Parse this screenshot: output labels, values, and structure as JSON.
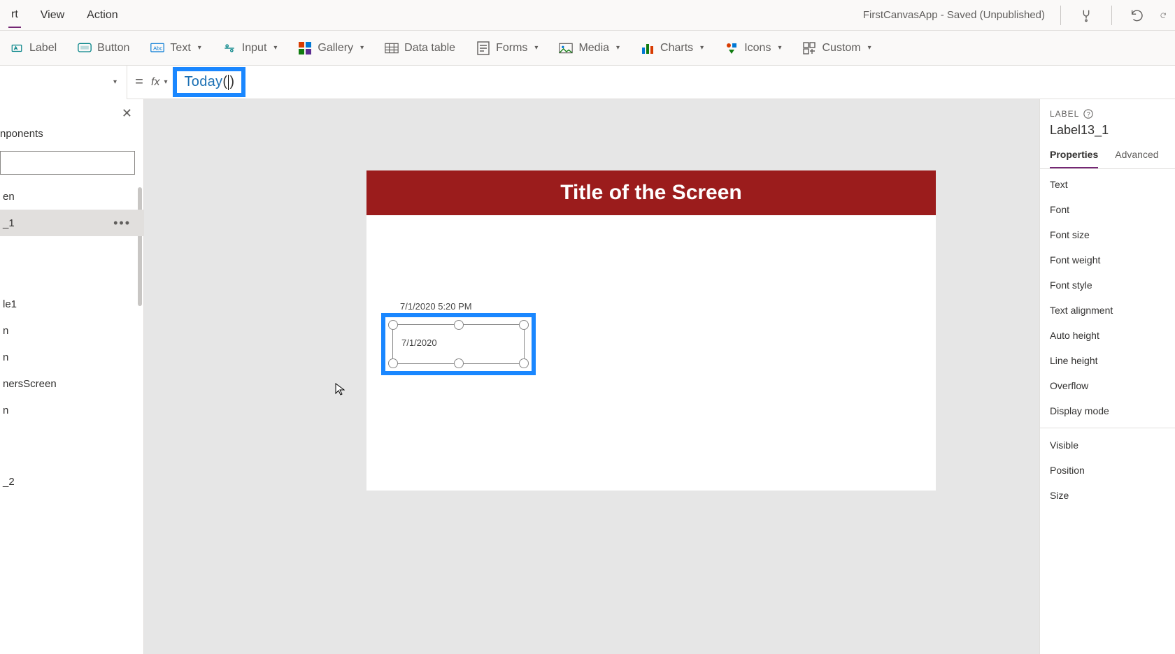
{
  "menubar": {
    "items": [
      "rt",
      "View",
      "Action"
    ],
    "app_status": "FirstCanvasApp - Saved (Unpublished)"
  },
  "ribbon": {
    "label": "Label",
    "button": "Button",
    "text": "Text",
    "input": "Input",
    "gallery": "Gallery",
    "data_table": "Data table",
    "forms": "Forms",
    "media": "Media",
    "charts": "Charts",
    "icons": "Icons",
    "custom": "Custom"
  },
  "formula": {
    "equals": "=",
    "fx": "fx",
    "value_pre": "Today",
    "value_open": "(",
    "value_close": ")"
  },
  "left_pane": {
    "tab_label": "nponents",
    "items": [
      {
        "label": "en"
      },
      {
        "label": "_1",
        "selected": true
      },
      {
        "label": "le1"
      },
      {
        "label": "n"
      },
      {
        "label": "n"
      },
      {
        "label": "nersScreen"
      },
      {
        "label": "n"
      },
      {
        "label": "_2"
      }
    ]
  },
  "canvas": {
    "header_title": "Title of the Screen",
    "datetime_label": "7/1/2020 5:20 PM",
    "selected_label_text": "7/1/2020"
  },
  "right_pane": {
    "type": "LABEL",
    "name": "Label13_1",
    "tabs": {
      "properties": "Properties",
      "advanced": "Advanced"
    },
    "props": [
      "Text",
      "Font",
      "Font size",
      "Font weight",
      "Font style",
      "Text alignment",
      "Auto height",
      "Line height",
      "Overflow",
      "Display mode"
    ],
    "props2": [
      "Visible",
      "Position",
      "Size"
    ]
  }
}
